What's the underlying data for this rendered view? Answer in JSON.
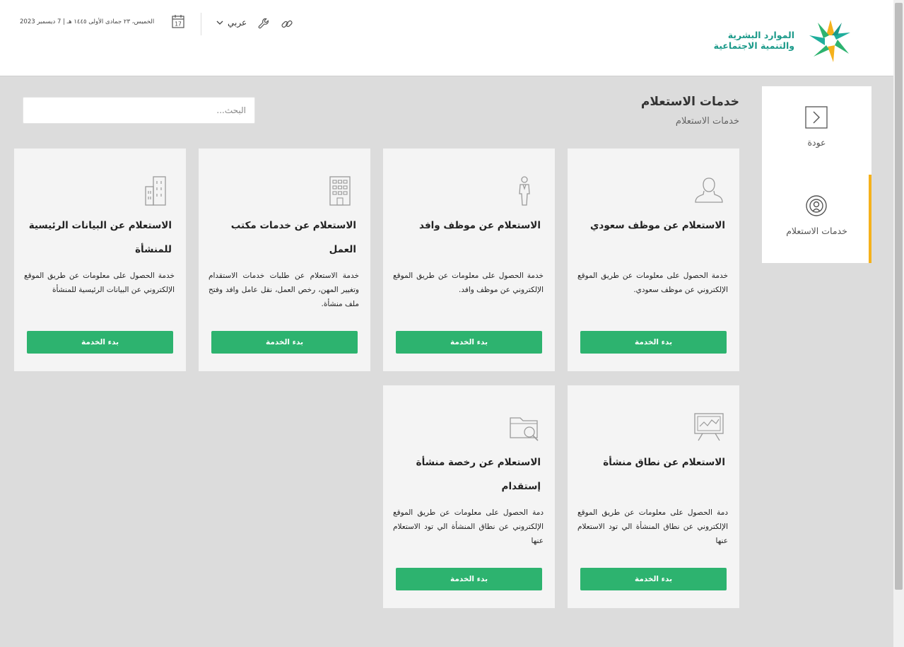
{
  "header": {
    "logo": {
      "line1": "الموارد البشرية",
      "line2": "والتنمية الاجتماعية"
    },
    "date": "الخميس، ٢٣ جمادى الأولى ١٤٤٥ هـ | 7 ديسمبر 2023",
    "calendar_day": "17",
    "language": "عربي"
  },
  "sidebar": {
    "items": [
      {
        "label": "عودة",
        "icon": "chevron-right-icon"
      },
      {
        "label": "خدمات الاستعلام",
        "icon": "broadcast-icon"
      }
    ],
    "active_color": "#f5b11b"
  },
  "page": {
    "title": "خدمات الاستعلام",
    "subtitle": "خدمات الاستعلام",
    "search_placeholder": "البحث..."
  },
  "colors": {
    "accent": "#2db36f",
    "header_bg": "#ffffff",
    "page_bg": "#dcdcdc"
  },
  "cards": [
    {
      "title": "الاستعلام عن موظف سعودي",
      "description": "خدمة الحصول على معلومات عن طريق الموقع الإلكتروني عن موظف سعودي.",
      "button": "بدء الخدمة",
      "icon": "user-icon"
    },
    {
      "title": "الاستعلام عن موظف وافد",
      "description": "خدمة الحصول على معلومات عن طريق الموقع الإلكتروني عن موظف وافد.",
      "button": "بدء الخدمة",
      "icon": "person-icon"
    },
    {
      "title": "الاستعلام عن خدمات مكتب العمل",
      "description": "خدمة الاستعلام عن طلبات خدمات الاستقدام وتغيير المهن، رخص العمل، نقل عامل وافد وفتح ملف منشأة.",
      "button": "بدء الخدمة",
      "icon": "building-icon"
    },
    {
      "title": "الاستعلام عن البيانات الرئيسية للمنشأة",
      "description": "خدمة الحصول على معلومات عن طريق الموقع الإلكتروني عن البيانات الرئيسية للمنشأة",
      "button": "بدء الخدمة",
      "icon": "buildings-icon"
    },
    {
      "title": "الاستعلام عن نطاق منشأة",
      "description": "دمة الحصول على معلومات عن طريق الموقع الإلكتروني عن نطاق المنشأة الي تود الاستعلام عنها",
      "button": "بدء الخدمة",
      "icon": "chart-board-icon"
    },
    {
      "title": "الاستعلام عن رخصة منشأة إستقدام",
      "description": "دمة الحصول على معلومات عن طريق الموقع الإلكتروني عن نطاق المنشأة الي تود الاستعلام عنها",
      "button": "بدء الخدمة",
      "icon": "folder-search-icon"
    }
  ]
}
